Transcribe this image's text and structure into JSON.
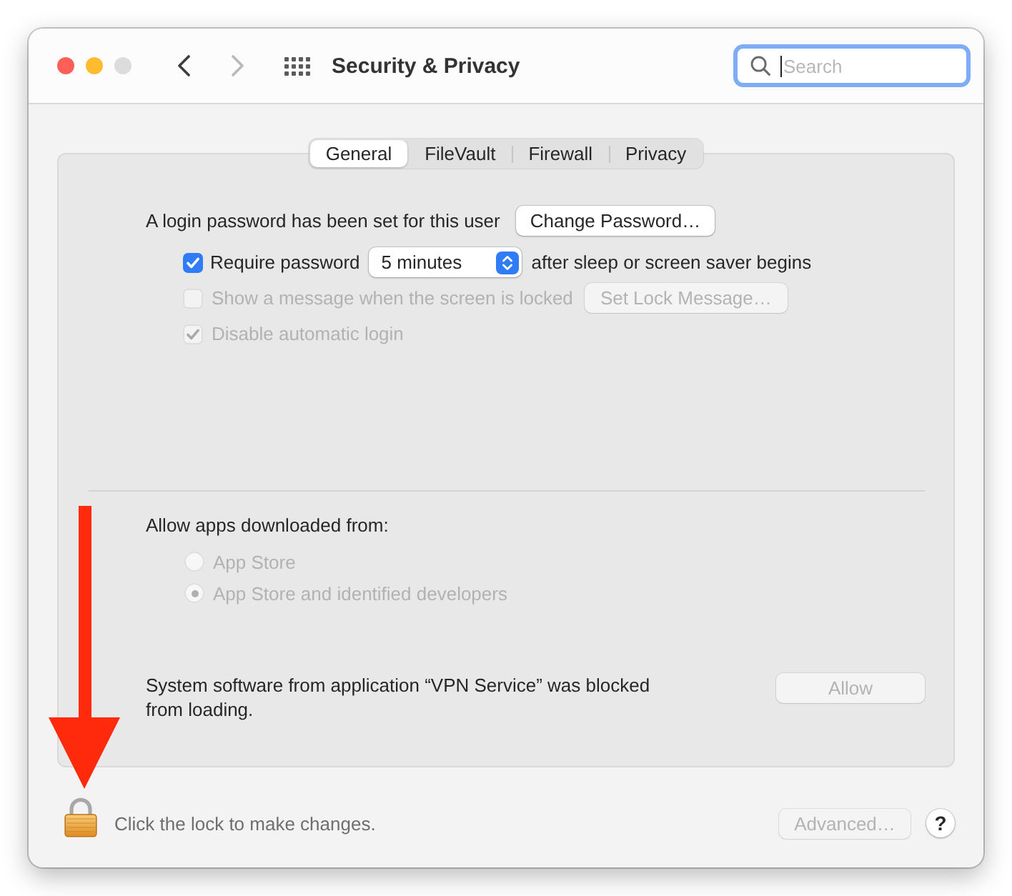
{
  "window": {
    "title": "Security & Privacy",
    "buttons": [
      {
        "kind": "close",
        "disabled": false
      },
      {
        "kind": "minimize",
        "disabled": false
      },
      {
        "kind": "zoom",
        "disabled": true
      }
    ]
  },
  "toolbar": {
    "navigation": [
      {
        "kind": "back",
        "disabled": false
      },
      {
        "kind": "forward",
        "disabled": true
      }
    ],
    "search": {
      "placeholder": "Search",
      "focused": true
    }
  },
  "tabs": [
    {
      "label": "General",
      "selected": true
    },
    {
      "label": "FileVault",
      "selected": false
    },
    {
      "label": "Firewall",
      "selected": false
    },
    {
      "label": "Privacy",
      "selected": false
    }
  ],
  "general": {
    "password_status": "A login password has been set for this user",
    "change_password_button": {
      "label": "Change Password…",
      "disabled": false
    },
    "options": [
      {
        "kind": "popup",
        "label": "Require password",
        "checked": true,
        "disabled": false,
        "value": "5 minutes",
        "suffix": "after sleep or screen saver begins"
      },
      {
        "kind": "button",
        "label": "Show a message when the screen is locked",
        "checked": false,
        "disabled": true,
        "button": "Set Lock Message…"
      },
      {
        "kind": "plain",
        "label": "Disable automatic login",
        "checked": true,
        "disabled": true
      }
    ]
  },
  "downloads": {
    "heading": "Allow apps downloaded from:",
    "options": [
      {
        "label": "App Store",
        "selected": false,
        "disabled": true
      },
      {
        "label": "App Store and identified developers",
        "selected": true,
        "disabled": true
      }
    ]
  },
  "blocked_notice": {
    "text": "System software from application “VPN Service” was blocked from loading.",
    "button": {
      "label": "Allow",
      "disabled": true
    }
  },
  "footer": {
    "locked": true,
    "lock_hint": "Click the lock to make changes.",
    "advanced_button": {
      "label": "Advanced…",
      "disabled": true
    },
    "help_button": "?"
  }
}
